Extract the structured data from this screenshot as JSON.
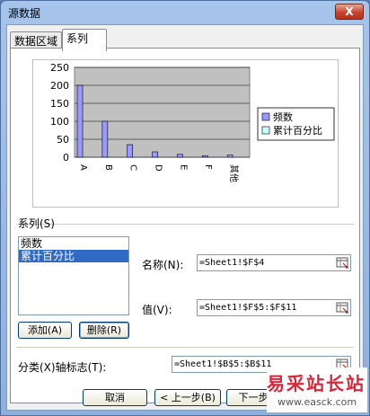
{
  "window": {
    "title": "源数据",
    "close_label": "X"
  },
  "tabs": [
    {
      "label": "数据区域",
      "active": false
    },
    {
      "label": "系列",
      "active": true
    }
  ],
  "chart_data": {
    "type": "bar",
    "categories": [
      "A",
      "B",
      "C",
      "D",
      "E",
      "F",
      "其他"
    ],
    "series": [
      {
        "name": "频数",
        "values": [
          200,
          100,
          35,
          15,
          8,
          4,
          6
        ],
        "color": "#9999ff"
      },
      {
        "name": "累计百分比",
        "values": [
          0,
          0,
          0,
          0,
          0,
          0,
          0
        ],
        "color": "#ccffff"
      }
    ],
    "yticks": [
      "250",
      "200",
      "150",
      "100",
      "50",
      "0"
    ],
    "ylim": [
      0,
      250
    ],
    "plot_bg": "#c0c0c0",
    "legend": "right"
  },
  "series_section": {
    "label": "系列(S)",
    "items": [
      "频数",
      "累计百分比"
    ],
    "selected_index": 1
  },
  "buttons": {
    "add": "添加(A)",
    "delete": "删除(R)",
    "cancel": "取消",
    "back": "< 上一步(B)",
    "next": "下一步"
  },
  "fields": {
    "name_label": "名称(N):",
    "name_value": "=Sheet1!$F$4",
    "values_label": "值(V):",
    "values_value": "=Sheet1!$F$5:$F$11",
    "category_label": "分类(X)轴标志(T):",
    "category_value": "=Sheet1!$B$5:$B$11"
  },
  "watermark": {
    "text": "易采站长站",
    "url": "www.easck.com"
  }
}
